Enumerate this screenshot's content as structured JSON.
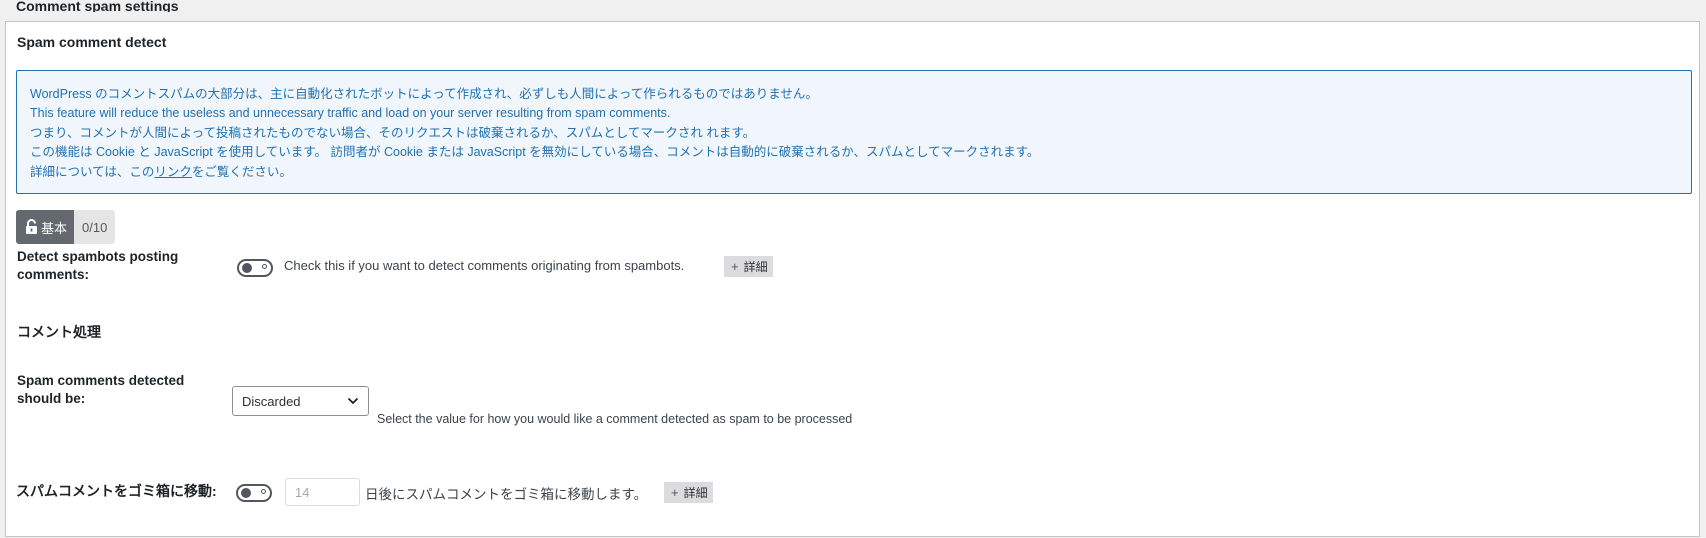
{
  "section": {
    "title": "Comment spam settings"
  },
  "panel": {
    "title": "Spam comment detect",
    "notice": {
      "line1": "WordPress のコメントスパムの大部分は、主に自動化されたボットによって作成され、必ずしも人間によって作られるものではありません。",
      "line2": "This feature will reduce the useless and unnecessary traffic and load on your server resulting from spam comments.",
      "line3": "つまり、コメントが人間によって投稿されたものでない場合、そのリクエストは破棄されるか、スパムとしてマークされ れます。",
      "line4": "この機能は Cookie と JavaScript を使用しています。 訪問者が Cookie または JavaScript を無効にしている場合、コメントは自動的に破棄されるか、スパムとしてマークされます。",
      "line5_prefix": "詳細については、この",
      "line5_link": "リンク",
      "line5_suffix": "をご覧ください。"
    },
    "level": {
      "icon": "lock-open-icon",
      "label": "基本",
      "count": "0/10"
    },
    "detect_spambots": {
      "label_line1": "Detect spambots posting",
      "label_line2": "comments:",
      "enabled": false,
      "description": "Check this if you want to detect comments originating from spambots.",
      "detail_label": "詳細"
    },
    "comment_processing": {
      "heading": "コメント処理"
    },
    "spam_action": {
      "label_line1": "Spam comments detected",
      "label_line2": "should be:",
      "selected": "Discarded",
      "description": "Select the value for how you would like a comment detected as spam to be processed"
    },
    "move_to_trash": {
      "label": "スパムコメントをゴミ箱に移動:",
      "enabled": false,
      "days_placeholder": "14",
      "description": "日後にスパムコメントをゴミ箱に移動します。",
      "detail_label": "詳細"
    }
  },
  "colors": {
    "notice_text": "#2271b1",
    "notice_bg": "#f0f6fc",
    "badge_bg": "#646970",
    "page_bg": "#f0f0f1"
  }
}
